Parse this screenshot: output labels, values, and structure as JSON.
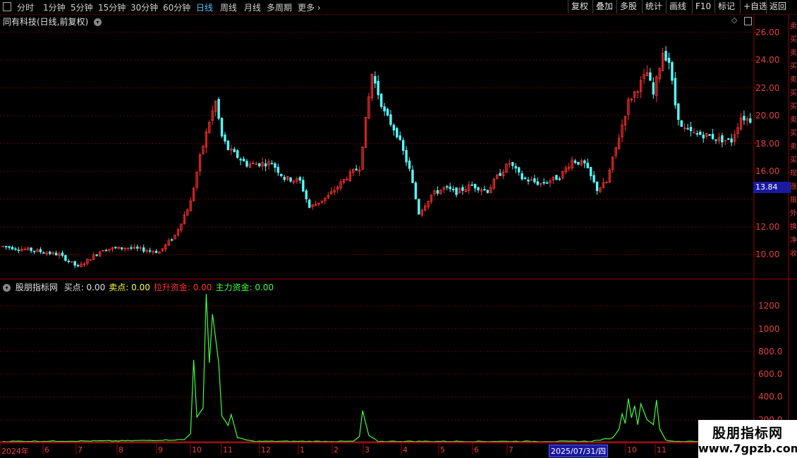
{
  "toolbar": {
    "left_items": [
      "分时",
      "1分钟",
      "5分钟",
      "15分钟",
      "30分钟",
      "60分钟",
      "日线",
      "周线",
      "月线",
      "多周期",
      "更多"
    ],
    "active_index": 6,
    "right_items": [
      "复权",
      "叠加",
      "多股",
      "统计",
      "画线",
      "F10",
      "标记",
      "+自选",
      "返回"
    ]
  },
  "price_panel": {
    "title": "同有科技(日线,前复权)",
    "y_ticks": [
      "26.00",
      "24.00",
      "22.00",
      "20.00",
      "18.00",
      "16.00",
      "12.00",
      "10.00"
    ],
    "current_price": "13.84"
  },
  "indicator_panel": {
    "name": "股朋指标网",
    "items": [
      {
        "label": "买点:",
        "value": "0.00",
        "color": "#e0e0e0"
      },
      {
        "label": "卖点:",
        "value": "0.00",
        "color": "#ffff40"
      },
      {
        "label": "拉升资金:",
        "value": "0.00",
        "color": "#ff3030"
      },
      {
        "label": "主力资金:",
        "value": "0.00",
        "color": "#40ff40"
      }
    ],
    "y_ticks": [
      "1200",
      "1000",
      "800.0",
      "600.0",
      "400.0",
      "200.0"
    ]
  },
  "x_axis": {
    "labels": [
      "2024年",
      "6",
      "7",
      "8",
      "9",
      "10",
      "11",
      "12",
      "1",
      "2",
      "3",
      "4",
      "5",
      "6",
      "7",
      "10",
      "11"
    ],
    "cursor_date": "2025/07/31/四"
  },
  "watermark": {
    "line1": "股朋指标网",
    "line2": "www.7gpzb.com"
  },
  "colors": {
    "up": "#ff3030",
    "down": "#54ffff",
    "grid": "#6a0000",
    "line": "#40ff40"
  },
  "chart_data": [
    {
      "type": "candlestick",
      "ylim": [
        8.3,
        26.8
      ],
      "anchors": [
        [
          0,
          10.6
        ],
        [
          10,
          10.3
        ],
        [
          18,
          10.0
        ],
        [
          24,
          9.1
        ],
        [
          32,
          10.4
        ],
        [
          40,
          10.5
        ],
        [
          50,
          10.2
        ],
        [
          55,
          11.4
        ],
        [
          60,
          13.8
        ],
        [
          63,
          17.0
        ],
        [
          66,
          19.6
        ],
        [
          68,
          21.0
        ],
        [
          70,
          18.5
        ],
        [
          72,
          17.6
        ],
        [
          78,
          16.5
        ],
        [
          86,
          16.6
        ],
        [
          90,
          15.5
        ],
        [
          95,
          15.3
        ],
        [
          98,
          13.4
        ],
        [
          104,
          14.2
        ],
        [
          110,
          15.6
        ],
        [
          114,
          16.3
        ],
        [
          118,
          23.0
        ],
        [
          122,
          20.2
        ],
        [
          126,
          18.7
        ],
        [
          130,
          16.1
        ],
        [
          133,
          13.0
        ],
        [
          137,
          14.3
        ],
        [
          141,
          14.8
        ],
        [
          145,
          14.5
        ],
        [
          150,
          15.0
        ],
        [
          155,
          14.6
        ],
        [
          158,
          15.6
        ],
        [
          162,
          16.6
        ],
        [
          166,
          15.5
        ],
        [
          172,
          15.1
        ],
        [
          178,
          15.6
        ],
        [
          182,
          16.8
        ],
        [
          186,
          16.5
        ],
        [
          190,
          14.7
        ],
        [
          193,
          15.2
        ],
        [
          197,
          18.5
        ],
        [
          200,
          21.0
        ],
        [
          203,
          22.0
        ],
        [
          206,
          23.1
        ],
        [
          208,
          21.5
        ],
        [
          211,
          24.6
        ],
        [
          213,
          23.9
        ],
        [
          215,
          20.8
        ],
        [
          217,
          19.1
        ],
        [
          221,
          18.7
        ],
        [
          225,
          18.6
        ],
        [
          229,
          18.3
        ],
        [
          233,
          18.2
        ],
        [
          236,
          19.9
        ],
        [
          239,
          19.7
        ]
      ],
      "high": 25.8,
      "low": 8.8
    },
    {
      "type": "line",
      "name": "主力资金",
      "ylim": [
        0,
        1400
      ],
      "anchors": [
        [
          0,
          10
        ],
        [
          40,
          15
        ],
        [
          58,
          25
        ],
        [
          60,
          80
        ],
        [
          61,
          730
        ],
        [
          62,
          220
        ],
        [
          64,
          300
        ],
        [
          65,
          1310
        ],
        [
          66,
          700
        ],
        [
          67,
          1130
        ],
        [
          69,
          700
        ],
        [
          70,
          230
        ],
        [
          72,
          150
        ],
        [
          73,
          250
        ],
        [
          75,
          40
        ],
        [
          80,
          10
        ],
        [
          112,
          10
        ],
        [
          114,
          50
        ],
        [
          115,
          280
        ],
        [
          117,
          60
        ],
        [
          120,
          10
        ],
        [
          188,
          10
        ],
        [
          195,
          40
        ],
        [
          197,
          120
        ],
        [
          198,
          250
        ],
        [
          199,
          170
        ],
        [
          200,
          390
        ],
        [
          201,
          220
        ],
        [
          202,
          320
        ],
        [
          203,
          160
        ],
        [
          204,
          340
        ],
        [
          206,
          200
        ],
        [
          208,
          160
        ],
        [
          209,
          370
        ],
        [
          210,
          120
        ],
        [
          212,
          20
        ],
        [
          215,
          10
        ],
        [
          239,
          10
        ]
      ]
    }
  ]
}
